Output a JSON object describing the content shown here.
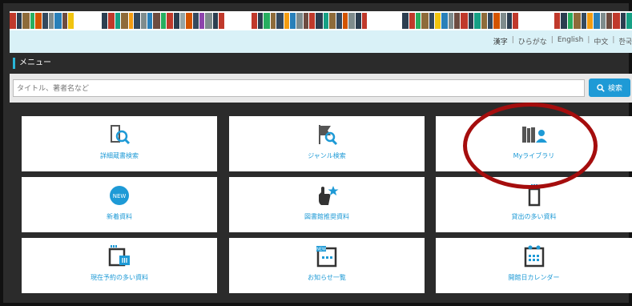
{
  "header": {
    "languages": [
      "漢字",
      "ひらがな",
      "English",
      "中文",
      "한국"
    ]
  },
  "menu": {
    "title": "メニュー"
  },
  "search": {
    "placeholder": "タイトル、著者名など",
    "button_label": "検索"
  },
  "tiles": [
    {
      "label": "詳細蔵書検索",
      "icon": "detailed-search-icon"
    },
    {
      "label": "ジャンル検索",
      "icon": "genre-search-icon"
    },
    {
      "label": "Myライブラリ",
      "icon": "my-library-icon"
    },
    {
      "label": "新着資料",
      "icon": "new-badge-icon"
    },
    {
      "label": "図書館推奨資料",
      "icon": "recommend-icon"
    },
    {
      "label": "貸出の多い資料",
      "icon": "popular-lending-icon"
    },
    {
      "label": "現在予約の多い資料",
      "icon": "popular-reservation-icon"
    },
    {
      "label": "お知らせ一覧",
      "icon": "notice-list-icon"
    },
    {
      "label": "開館日カレンダー",
      "icon": "calendar-icon"
    }
  ],
  "colors": {
    "accent": "#1e9ad6",
    "annotation": "#a50d0d",
    "header_band": "#d9f1f7",
    "background": "#2b2b2b"
  }
}
